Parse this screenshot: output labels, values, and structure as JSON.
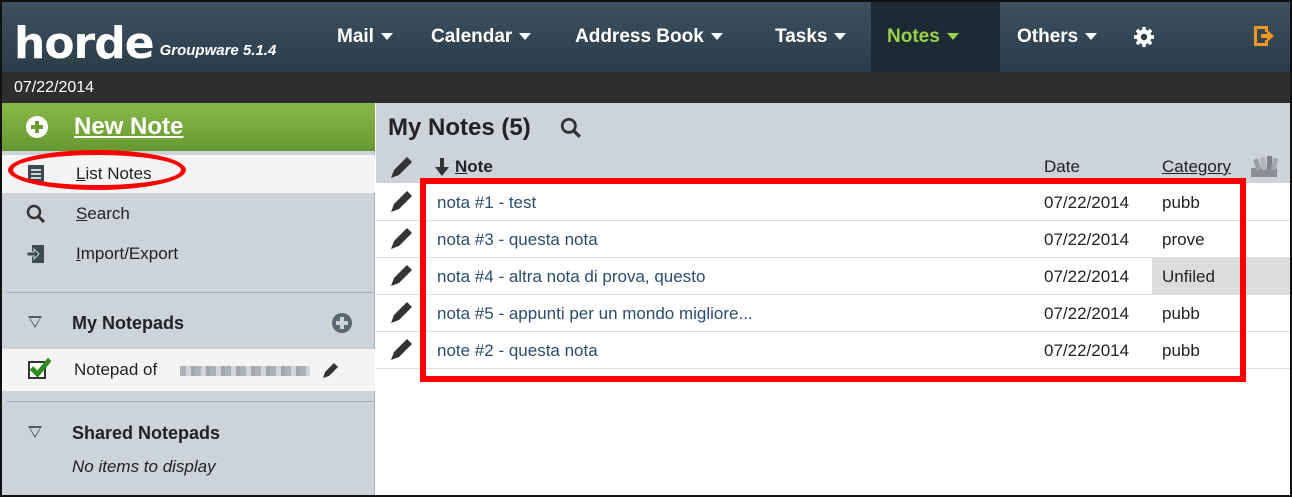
{
  "app": {
    "logo": "horde",
    "subtitle": "Groupware 5.1.4"
  },
  "menu": [
    "Mail",
    "Calendar",
    "Address Book",
    "Tasks",
    "Notes",
    "Others"
  ],
  "date": "07/22/2014",
  "sidebar": {
    "new_note": "New Note",
    "items": [
      "List Notes",
      "Search",
      "Import/Export"
    ],
    "my_notepads": "My Notepads",
    "notepad": "Notepad of",
    "shared_notepads": "Shared Notepads",
    "no_items": "No items to display"
  },
  "main": {
    "title": "My Notes (5)",
    "columns": {
      "note": "Note",
      "date": "Date",
      "category": "Category"
    },
    "rows": [
      {
        "note": "nota #1 - test",
        "date": "07/22/2014",
        "category": "pubb"
      },
      {
        "note": "nota #3 - questa nota",
        "date": "07/22/2014",
        "category": "prove"
      },
      {
        "note": "nota #4 - altra nota di prova, questo",
        "date": "07/22/2014",
        "category": "Unfiled"
      },
      {
        "note": "nota #5 - appunti per un mondo migliore...",
        "date": "07/22/2014",
        "category": "pubb"
      },
      {
        "note": "note #2 - questa nota",
        "date": "07/22/2014",
        "category": "pubb"
      }
    ]
  },
  "colors": {
    "topbar": "#2c3c49",
    "active_menu_text": "#9bd04a",
    "new_note_green": "#679830",
    "sidebar": "#ccd4d9",
    "highlight_red": "#ff0000"
  },
  "icons": [
    "gear-icon",
    "logout-icon",
    "add-icon",
    "list-icon",
    "search-icon",
    "import-export-icon",
    "pencil-icon",
    "sort-down-icon",
    "category-icon"
  ]
}
